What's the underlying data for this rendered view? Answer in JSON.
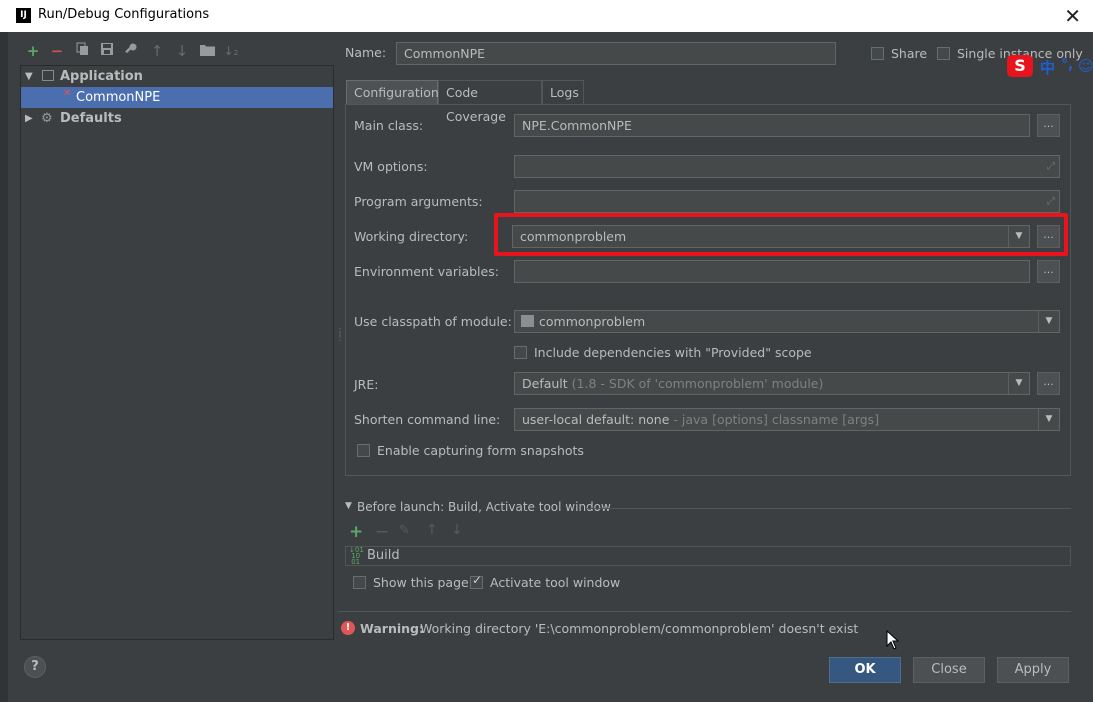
{
  "window": {
    "title": "Run/Debug Configurations",
    "app_icon_text": "IJ"
  },
  "toolbar": {
    "icons": [
      "add-icon",
      "remove-icon",
      "copy-icon",
      "save-icon",
      "wrench-icon",
      "arrow-up-icon",
      "arrow-down-icon",
      "folder-icon",
      "sort-icon"
    ]
  },
  "tree": {
    "application_label": "Application",
    "config_label": "CommonNPE",
    "defaults_label": "Defaults"
  },
  "header": {
    "name_label": "Name:",
    "name_value": "CommonNPE",
    "share_label": "Share",
    "single_instance_label": "Single instance only"
  },
  "tabs": [
    {
      "label": "Configuration",
      "active": true
    },
    {
      "label": "Code Coverage",
      "active": false
    },
    {
      "label": "Logs",
      "active": false
    }
  ],
  "form": {
    "main_class_label": "Main class:",
    "main_class_value": "NPE.CommonNPE",
    "vm_options_label": "VM options:",
    "program_args_label": "Program arguments:",
    "working_dir_label": "Working directory:",
    "working_dir_value": "commonproblem",
    "env_vars_label": "Environment variables:",
    "classpath_label": "Use classpath of module:",
    "classpath_value": "commonproblem",
    "include_deps_label": "Include dependencies with \"Provided\" scope",
    "jre_label": "JRE:",
    "jre_value": "Default",
    "jre_hint": "(1.8 - SDK of 'commonproblem' module)",
    "shorten_label": "Shorten command line:",
    "shorten_value": "user-local default: none",
    "shorten_hint": "- java [options] classname [args]",
    "capture_label": "Enable capturing form snapshots",
    "ellipsis": "..."
  },
  "before_launch": {
    "title": "Before launch: Build, Activate tool window",
    "build_label": "Build",
    "show_page_label": "Show this page",
    "activate_label": "Activate tool window"
  },
  "warning": {
    "bold": "Warning:",
    "text": "Working directory 'E:\\commonproblem/commonproblem' doesn't exist"
  },
  "buttons": {
    "ok": "OK",
    "close": "Close",
    "apply": "Apply",
    "help": "?"
  },
  "ime": {
    "logo": "S",
    "text": "中"
  },
  "colors": {
    "highlight_box": "#e8131d",
    "selection": "#4b6eaf",
    "ok_button": "#365880",
    "warning_icon": "#e05555"
  }
}
